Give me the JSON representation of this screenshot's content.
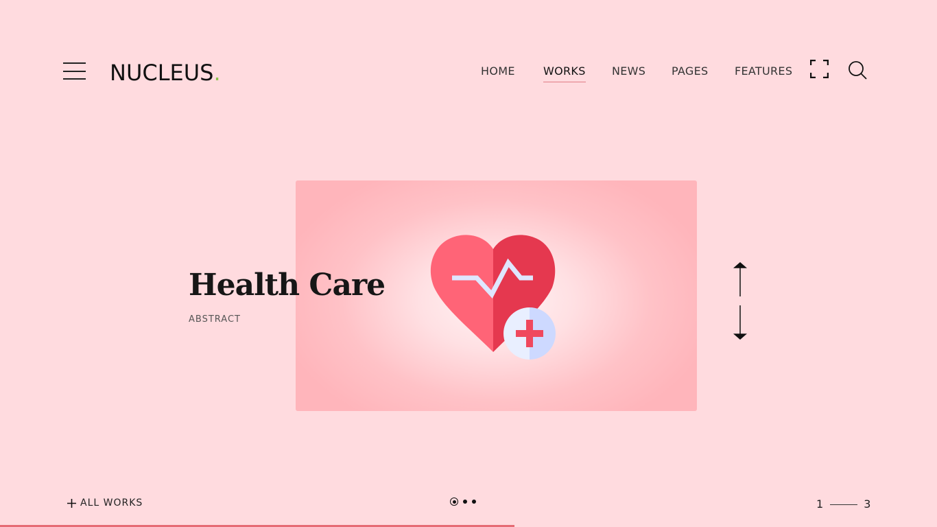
{
  "brand": {
    "name": "NUCLEUS",
    "dot": "."
  },
  "nav": {
    "items": [
      {
        "label": "HOME",
        "active": false
      },
      {
        "label": "WORKS",
        "active": true
      },
      {
        "label": "NEWS",
        "active": false
      },
      {
        "label": "PAGES",
        "active": false
      },
      {
        "label": "FEATURES",
        "active": false
      }
    ]
  },
  "icons": {
    "menu": "hamburger-menu-icon",
    "fullscreen": "fullscreen-icon",
    "search": "search-icon",
    "up": "arrow-up-icon",
    "down": "arrow-down-icon",
    "plus": "plus-icon",
    "illustration": "heart-health-icon"
  },
  "hero": {
    "title": "Health Care",
    "category": "ABSTRACT"
  },
  "footer": {
    "all_works": "ALL WORKS",
    "current": "1",
    "total": "3",
    "dots_count": 3,
    "active_dot": 1
  },
  "progress": {
    "fraction": 0.549
  },
  "colors": {
    "background": "#ffdbdf",
    "accent": "#e66b74",
    "brand_dot": "#8bc34a",
    "heart_left": "#ff6477",
    "heart_right": "#e5384f",
    "card": "#ffb5bb"
  }
}
